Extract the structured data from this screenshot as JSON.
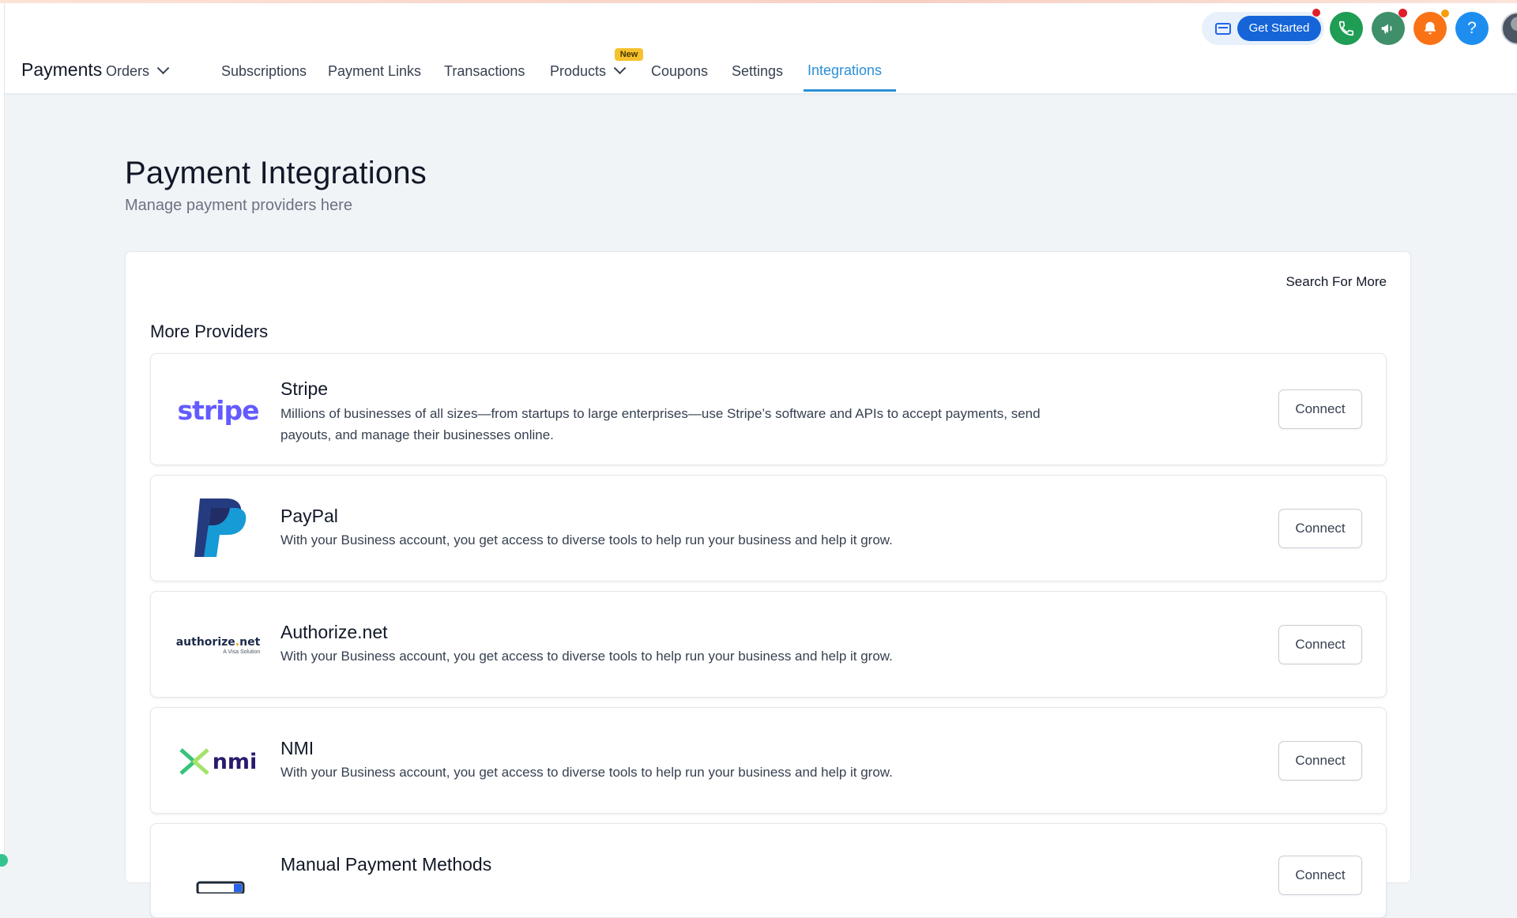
{
  "header": {
    "brand": "Payments",
    "nav": [
      {
        "label": "Orders",
        "has_dropdown": true
      },
      {
        "label": "Subscriptions"
      },
      {
        "label": "Payment Links"
      },
      {
        "label": "Transactions"
      },
      {
        "label": "Products",
        "has_dropdown": true,
        "badge": "New"
      },
      {
        "label": "Coupons"
      },
      {
        "label": "Settings"
      },
      {
        "label": "Integrations",
        "active": true
      }
    ],
    "get_started_label": "Get Started",
    "help_label": "?",
    "icons": {
      "card": "credit-card-icon",
      "phone": "phone-icon",
      "megaphone": "megaphone-icon",
      "bell": "bell-icon",
      "help": "help-icon",
      "avatar": "avatar"
    },
    "colors": {
      "active": "#2b8fd6",
      "get_started": "#1565d8",
      "phone_bg": "#1f9d55",
      "megaphone_bg": "#3f8f6a",
      "bell_bg": "#f97316",
      "help_bg": "#1d8ef0"
    }
  },
  "page": {
    "title": "Payment Integrations",
    "subtitle": "Manage payment providers here"
  },
  "card": {
    "search_more": "Search For More",
    "section_title": "More Providers",
    "providers": [
      {
        "name": "Stripe",
        "logo_text": "stripe",
        "description": "Millions of businesses of all sizes—from startups to large enterprises—use Stripe’s software and APIs to accept payments, send payouts, and manage their businesses online.",
        "button": "Connect"
      },
      {
        "name": "PayPal",
        "logo_text": "",
        "description": "With your Business account, you get access to diverse tools to help run your business and help it grow.",
        "button": "Connect"
      },
      {
        "name": "Authorize.net",
        "logo_text": "authorize.net",
        "logo_sub": "A Visa Solution",
        "description": "With your Business account, you get access to diverse tools to help run your business and help it grow.",
        "button": "Connect"
      },
      {
        "name": "NMI",
        "logo_text": "nmi",
        "description": "With your Business account, you get access to diverse tools to help run your business and help it grow.",
        "button": "Connect"
      },
      {
        "name": "Manual Payment Methods",
        "button": "Connect"
      }
    ]
  }
}
